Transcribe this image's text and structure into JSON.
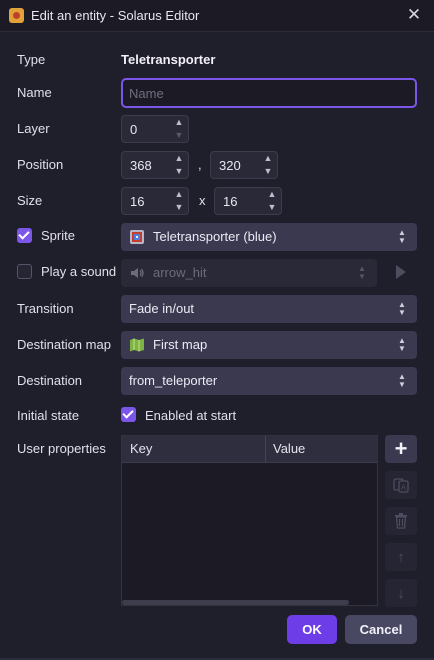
{
  "window": {
    "title": "Edit an entity - Solarus Editor",
    "close_glyph": "✕"
  },
  "form": {
    "type_label": "Type",
    "type_value": "Teletransporter",
    "name_label": "Name",
    "name_placeholder": "Name",
    "name_value": "",
    "layer_label": "Layer",
    "layer_value": "0",
    "position_label": "Position",
    "position_x": "368",
    "position_sep": ",",
    "position_y": "320",
    "size_label": "Size",
    "size_w": "16",
    "size_sep": "x",
    "size_h": "16",
    "sprite_label": "Sprite",
    "sprite_checked": true,
    "sprite_value": "Teletransporter (blue)",
    "sound_label": "Play a sound",
    "sound_checked": false,
    "sound_value": "arrow_hit",
    "transition_label": "Transition",
    "transition_value": "Fade in/out",
    "dest_map_label": "Destination map",
    "dest_map_value": "First map",
    "destination_label": "Destination",
    "destination_value": "from_teleporter",
    "initial_state_label": "Initial state",
    "initial_state_checked": true,
    "initial_state_value": "Enabled at start",
    "user_props_label": "User properties"
  },
  "table": {
    "columns": [
      "Key",
      "Value"
    ],
    "rows": []
  },
  "side_buttons": {
    "add": "+",
    "change_key": "⎘",
    "delete": "🗑",
    "up": "↑",
    "down": "↓"
  },
  "spin": {
    "up": "▲",
    "down": "▼"
  },
  "combo_arrows": {
    "up": "▲",
    "down": "▼"
  },
  "actions": {
    "ok": "OK",
    "cancel": "Cancel"
  },
  "colors": {
    "accent": "#7c56e8",
    "ok_button": "#6d3ee8",
    "background": "#1f1e2b"
  }
}
